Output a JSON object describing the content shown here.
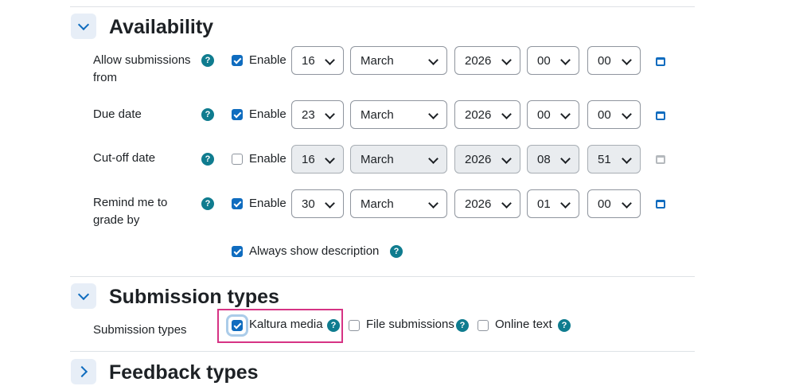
{
  "availability": {
    "title": "Availability",
    "rows": [
      {
        "label_line1": "Allow submissions",
        "label_line2": "from",
        "enabled": true,
        "enable_label": "Enable",
        "day": "16",
        "month": "March",
        "year": "2026",
        "hour": "00",
        "minute": "00"
      },
      {
        "label_line1": "Due date",
        "enabled": true,
        "enable_label": "Enable",
        "day": "23",
        "month": "March",
        "year": "2026",
        "hour": "00",
        "minute": "00"
      },
      {
        "label_line1": "Cut-off date",
        "enabled": false,
        "enable_label": "Enable",
        "day": "16",
        "month": "March",
        "year": "2026",
        "hour": "08",
        "minute": "51"
      },
      {
        "label_line1": "Remind me to",
        "label_line2": "grade by",
        "enabled": true,
        "enable_label": "Enable",
        "day": "30",
        "month": "March",
        "year": "2026",
        "hour": "01",
        "minute": "00"
      }
    ],
    "always_show_description": {
      "label": "Always show description",
      "checked": true
    }
  },
  "submission_types": {
    "title": "Submission types",
    "label": "Submission types",
    "options": [
      {
        "label": "Kaltura media",
        "checked": true
      },
      {
        "label": "File submissions",
        "checked": false
      },
      {
        "label": "Online text",
        "checked": false
      }
    ]
  },
  "feedback_types": {
    "title": "Feedback types"
  },
  "help_glyph": "?",
  "colors": {
    "accent": "#0f6cbf",
    "help": "#0f7c8f",
    "highlight": "#d63384",
    "disabled_bg": "#e9ecef"
  }
}
